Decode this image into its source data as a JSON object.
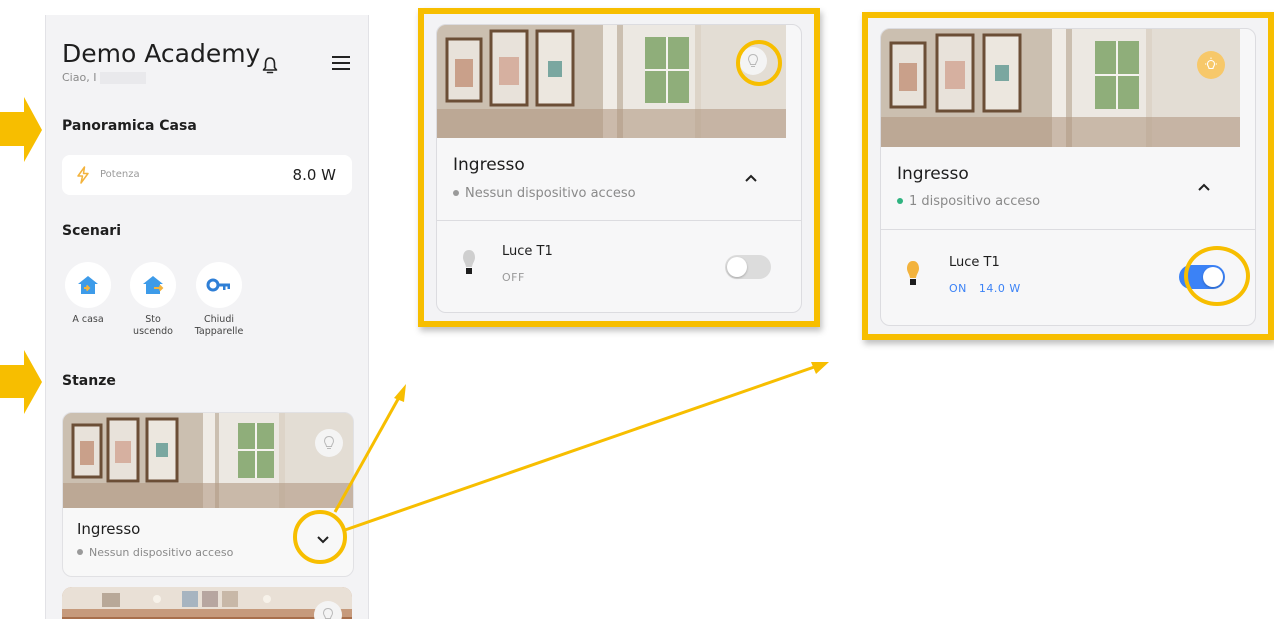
{
  "app": {
    "title": "Demo Academy",
    "greeting": "Ciao, I"
  },
  "sections": {
    "overview": "Panoramica Casa",
    "scenes": "Scenari",
    "rooms": "Stanze"
  },
  "power": {
    "label": "Potenza",
    "value": "8.0 W"
  },
  "scenes": [
    {
      "label": "A casa",
      "icon": "home-arrive-icon"
    },
    {
      "label": "Sto\nuscendo",
      "icon": "home-leave-icon"
    },
    {
      "label": "Chiudi\nTapparelle",
      "icon": "key-icon"
    }
  ],
  "room": {
    "name": "Ingresso",
    "status_off": "Nessun dispositivo acceso",
    "status_on": "1 dispositivo acceso"
  },
  "device": {
    "name": "Luce T1",
    "state_off": "OFF",
    "state_on": "ON",
    "power_on": "14.0 W",
    "level_on": 1,
    "level_off": 0
  },
  "colors": {
    "accent": "#f7be00",
    "toggle_on": "#3b82f6",
    "status_on": "#2fb380",
    "status_off": "#8a8a8a",
    "bulb_on": "#f3b33d"
  }
}
